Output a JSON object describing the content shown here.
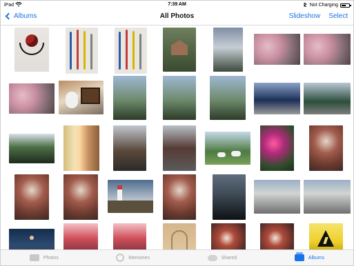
{
  "status_bar": {
    "carrier": "iPad",
    "wifi_icon": "wifi-icon",
    "time": "7:39 AM",
    "bluetooth_icon": "bluetooth-icon",
    "battery_text": "Not Charging",
    "battery_level": 0.55
  },
  "navbar": {
    "back_label": "Albums",
    "title": "All Photos",
    "slideshow_label": "Slideshow",
    "select_label": "Select"
  },
  "tabbar": {
    "items": [
      {
        "label": "Photos",
        "icon": "photos-icon",
        "active": false
      },
      {
        "label": "Memories",
        "icon": "memories-icon",
        "active": false
      },
      {
        "label": "Shared",
        "icon": "shared-icon",
        "active": false
      },
      {
        "label": "Albums",
        "icon": "albums-icon",
        "active": true
      }
    ]
  },
  "grid": {
    "thumbnails": [
      {
        "subject": "headphones"
      },
      {
        "subject": "pens"
      },
      {
        "subject": "pens"
      },
      {
        "subject": "house"
      },
      {
        "subject": "sky"
      },
      {
        "subject": "blossoms"
      },
      {
        "subject": "blossoms"
      },
      {
        "subject": "blossoms"
      },
      {
        "subject": "child with tv"
      },
      {
        "subject": "garden"
      },
      {
        "subject": "garden"
      },
      {
        "subject": "garden"
      },
      {
        "subject": "sunrise landscape"
      },
      {
        "subject": "tree"
      },
      {
        "subject": "tree and hedge"
      },
      {
        "subject": "rainbow light"
      },
      {
        "subject": "tram"
      },
      {
        "subject": "tram"
      },
      {
        "subject": "sheep"
      },
      {
        "subject": "flowers"
      },
      {
        "subject": "berries"
      },
      {
        "subject": "berries"
      },
      {
        "subject": "berries"
      },
      {
        "subject": "lighthouse"
      },
      {
        "subject": "berries"
      },
      {
        "subject": "twigs"
      },
      {
        "subject": "sunset"
      },
      {
        "subject": "sunset"
      },
      {
        "subject": "night"
      },
      {
        "subject": "red flowers"
      },
      {
        "subject": "red flowers"
      },
      {
        "subject": "arch"
      },
      {
        "subject": "berries"
      },
      {
        "subject": "berries"
      },
      {
        "subject": "warning sign"
      }
    ]
  }
}
